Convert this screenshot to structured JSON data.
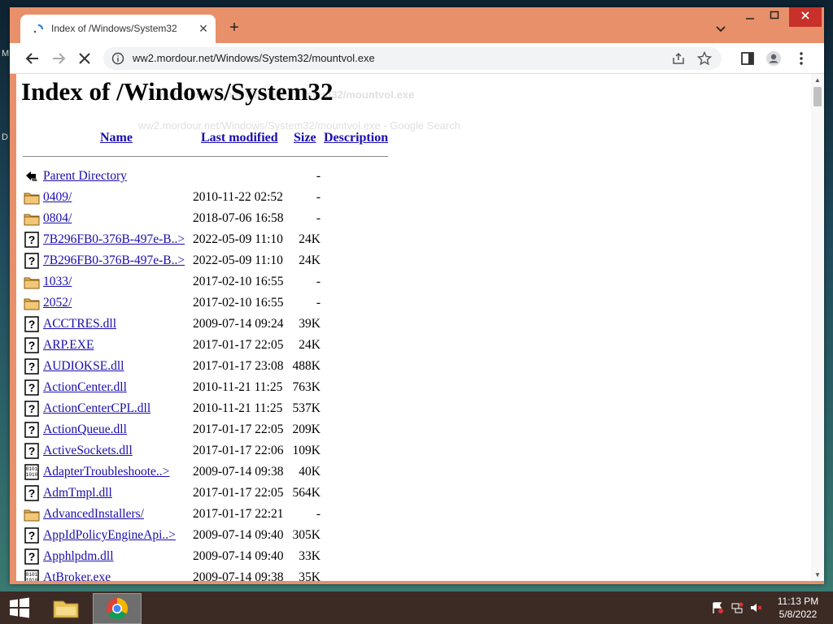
{
  "browser": {
    "tab_title": "Index of /Windows/System32",
    "url": "ww2.mordour.net/Windows/System32/mountvol.exe",
    "new_tab_label": "+",
    "close_label": "✕"
  },
  "desktop": {
    "edge_letters": [
      "M",
      "D"
    ]
  },
  "page": {
    "heading": "Index of /Windows/System32",
    "columns": {
      "name": "Name",
      "last_modified": "Last modified",
      "size": "Size",
      "description": "Description"
    },
    "ghost_suggestion": {
      "title": "ww2.mordour.net/Windows/System32/mountvol.exe",
      "url_line": "ww2.mordour.net/Windows/System32/mountvol.exe - Google Search"
    },
    "entries": [
      {
        "icon": "back-icon",
        "name": "Parent Directory",
        "date": "",
        "size": "-"
      },
      {
        "icon": "folder-icon",
        "name": "0409/",
        "date": "2010-11-22 02:52",
        "size": "-"
      },
      {
        "icon": "folder-icon",
        "name": "0804/",
        "date": "2018-07-06 16:58",
        "size": "-"
      },
      {
        "icon": "unknown-file-icon",
        "name": "7B296FB0-376B-497e-B..>",
        "date": "2022-05-09 11:10",
        "size": "24K"
      },
      {
        "icon": "unknown-file-icon",
        "name": "7B296FB0-376B-497e-B..>",
        "date": "2022-05-09 11:10",
        "size": "24K"
      },
      {
        "icon": "folder-icon",
        "name": "1033/",
        "date": "2017-02-10 16:55",
        "size": "-"
      },
      {
        "icon": "folder-icon",
        "name": "2052/",
        "date": "2017-02-10 16:55",
        "size": "-"
      },
      {
        "icon": "unknown-file-icon",
        "name": "ACCTRES.dll",
        "date": "2009-07-14 09:24",
        "size": "39K"
      },
      {
        "icon": "unknown-file-icon",
        "name": "ARP.EXE",
        "date": "2017-01-17 22:05",
        "size": "24K"
      },
      {
        "icon": "unknown-file-icon",
        "name": "AUDIOKSE.dll",
        "date": "2017-01-17 23:08",
        "size": "488K"
      },
      {
        "icon": "unknown-file-icon",
        "name": "ActionCenter.dll",
        "date": "2010-11-21 11:25",
        "size": "763K"
      },
      {
        "icon": "unknown-file-icon",
        "name": "ActionCenterCPL.dll",
        "date": "2010-11-21 11:25",
        "size": "537K"
      },
      {
        "icon": "unknown-file-icon",
        "name": "ActionQueue.dll",
        "date": "2017-01-17 22:05",
        "size": "209K"
      },
      {
        "icon": "unknown-file-icon",
        "name": "ActiveSockets.dll",
        "date": "2017-01-17 22:06",
        "size": "109K"
      },
      {
        "icon": "binary-file-icon",
        "name": "AdapterTroubleshoote..>",
        "date": "2009-07-14 09:38",
        "size": "40K"
      },
      {
        "icon": "unknown-file-icon",
        "name": "AdmTmpl.dll",
        "date": "2017-01-17 22:05",
        "size": "564K"
      },
      {
        "icon": "folder-icon",
        "name": "AdvancedInstallers/",
        "date": "2017-01-17 22:21",
        "size": "-"
      },
      {
        "icon": "unknown-file-icon",
        "name": "AppIdPolicyEngineApi..>",
        "date": "2009-07-14 09:40",
        "size": "305K"
      },
      {
        "icon": "unknown-file-icon",
        "name": "Apphlpdm.dll",
        "date": "2009-07-14 09:40",
        "size": "33K"
      },
      {
        "icon": "binary-file-icon",
        "name": "AtBroker.exe",
        "date": "2009-07-14 09:38",
        "size": "35K"
      }
    ]
  },
  "taskbar": {
    "time": "11:13 PM",
    "date": "5/8/2022"
  },
  "colors": {
    "window_frame": "#e8906a",
    "link": "#1a0dab",
    "close_button": "#c8302a",
    "taskbar": "#3c2a24"
  }
}
